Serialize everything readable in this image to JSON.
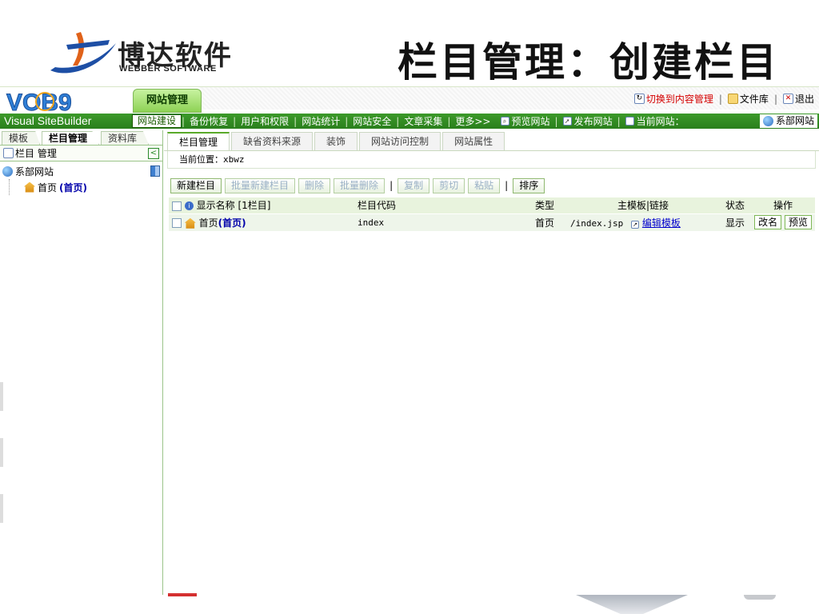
{
  "slide": {
    "logo_cn": "博达软件",
    "logo_en": "WEBBER SOFTWARE",
    "title": "栏目管理：创建栏目"
  },
  "app": {
    "product_logo": "VOB9",
    "product_name": "Visual SiteBuilder",
    "site_tab": "网站管理",
    "top_links": {
      "switch": "切换到内容管理",
      "files": "文件库",
      "logout": "退出"
    },
    "nav": [
      {
        "label": "网站建设",
        "active": true
      },
      {
        "label": "备份恢复"
      },
      {
        "label": "用户和权限"
      },
      {
        "label": "网站统计"
      },
      {
        "label": "网站安全"
      },
      {
        "label": "文章采集"
      },
      {
        "label": "更多>>"
      },
      {
        "label": "预览网站"
      },
      {
        "label": "发布网站"
      }
    ],
    "current_site_label": "当前网站：",
    "current_site_value": "系部网站"
  },
  "left": {
    "tabs": [
      "模板",
      "栏目管理",
      "资料库"
    ],
    "header": "栏目 管理",
    "tree": {
      "root": "系部网站",
      "child_name": "首页",
      "child_tag": "(首页)"
    }
  },
  "right": {
    "tabs": [
      "栏目管理",
      "缺省资料来源",
      "装饰",
      "网站访问控制",
      "网站属性"
    ],
    "breadcrumb_label": "当前位置：",
    "breadcrumb_value": "xbwz",
    "toolbar": {
      "new": "新建栏目",
      "batch_new": "批量新建栏目",
      "delete": "删除",
      "batch_delete": "批量删除",
      "copy": "复制",
      "cut": "剪切",
      "paste": "粘贴",
      "sort": "排序"
    },
    "columns": {
      "name": "显示名称 [1栏目]",
      "code": "栏目代码",
      "type": "类型",
      "template": "主模板|链接",
      "status": "状态",
      "ops": "操作"
    },
    "rows": [
      {
        "name": "首页",
        "name_tag": "(首页)",
        "code": "index",
        "type": "首页",
        "template": "/index.jsp",
        "edit_link": "编辑模板",
        "status": "显示",
        "rename": "改名",
        "preview": "预览"
      }
    ]
  },
  "colors": {
    "nav_green": "#2a7f1c",
    "tab_green": "#8ed255",
    "row_bg": "#eef5ea",
    "header_bg": "#e8f3dd",
    "link_blue": "#0000cc",
    "alert_red": "#d40000"
  }
}
